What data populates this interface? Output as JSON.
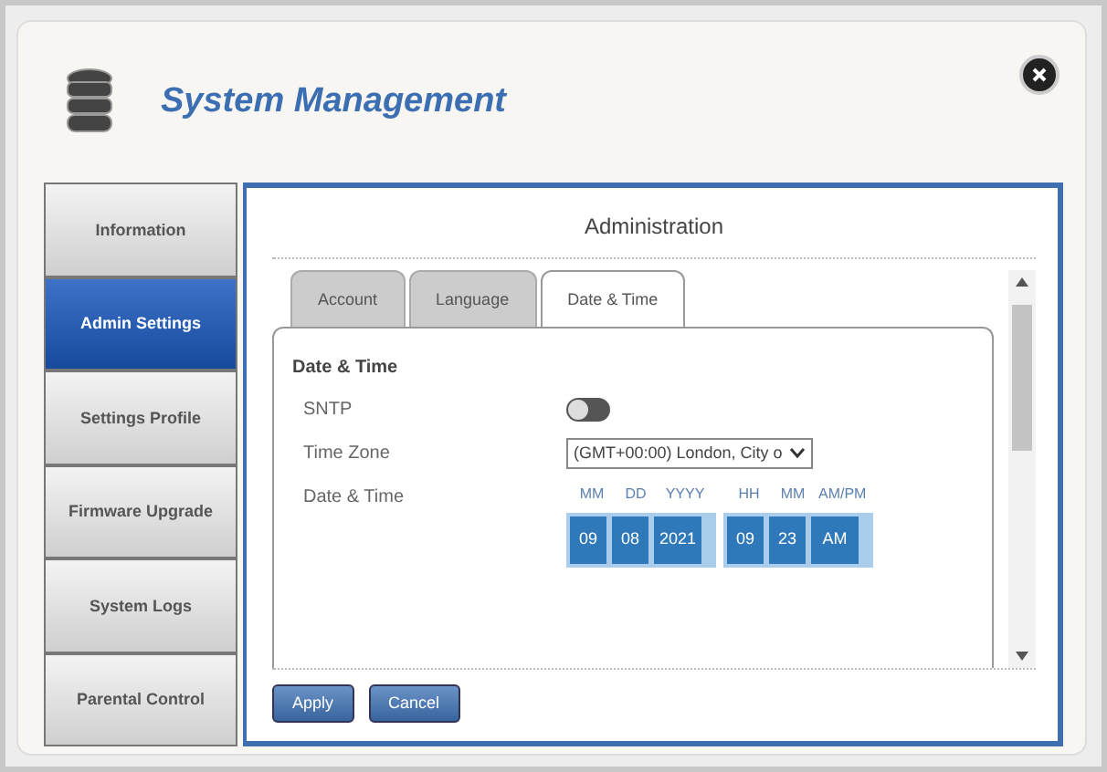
{
  "window": {
    "title": "System Management"
  },
  "sidebar": {
    "items": [
      {
        "label": "Information",
        "selected": false
      },
      {
        "label": "Admin Settings",
        "selected": true
      },
      {
        "label": "Settings Profile",
        "selected": false
      },
      {
        "label": "Firmware Upgrade",
        "selected": false
      },
      {
        "label": "System Logs",
        "selected": false
      },
      {
        "label": "Parental Control",
        "selected": false
      }
    ]
  },
  "panel": {
    "title": "Administration",
    "tabs": [
      {
        "label": "Account",
        "selected": false
      },
      {
        "label": "Language",
        "selected": false
      },
      {
        "label": "Date & Time",
        "selected": true
      }
    ],
    "section_title": "Date & Time",
    "sntp": {
      "label": "SNTP",
      "on": false
    },
    "time_zone": {
      "label": "Time Zone",
      "value": "(GMT+00:00) London, City o"
    },
    "date_time": {
      "label": "Date & Time",
      "groups": [
        [
          {
            "unit": "MM",
            "value": "09"
          },
          {
            "unit": "DD",
            "value": "08"
          },
          {
            "unit": "YYYY",
            "value": "2021"
          }
        ],
        [
          {
            "unit": "HH",
            "value": "09"
          },
          {
            "unit": "MM",
            "value": "23"
          },
          {
            "unit": "AM/PM",
            "value": "AM"
          }
        ]
      ]
    },
    "buttons": [
      "Apply",
      "Cancel"
    ]
  }
}
